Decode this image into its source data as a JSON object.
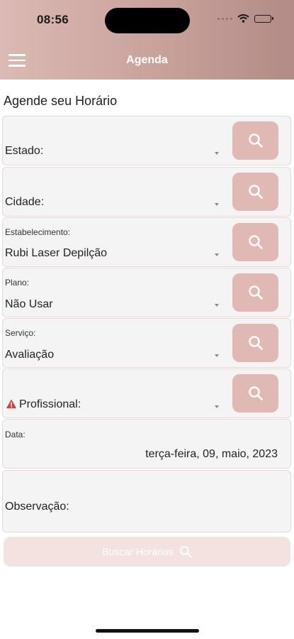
{
  "status_bar": {
    "time": "08:56"
  },
  "nav": {
    "title": "Agenda",
    "menu_icon": "hamburger-menu-icon"
  },
  "page": {
    "title": "Agende seu Horário"
  },
  "fields": {
    "estado": {
      "label": "Estado:"
    },
    "cidade": {
      "label": "Cidade:"
    },
    "estabelecimento": {
      "label": "Estabelecimento:",
      "value": "Rubi Laser Depilção"
    },
    "plano": {
      "label": "Plano:",
      "value": "Não Usar"
    },
    "servico": {
      "label": "Serviço:",
      "value": "Avaliação"
    },
    "profissional": {
      "label": "Profissional:",
      "icon": "warning-icon"
    },
    "data": {
      "label": "Data:",
      "value": "terça-feira, 09, maio, 2023"
    },
    "observacao": {
      "label": "Observação:"
    }
  },
  "actions": {
    "buscar_label": "Buscar Horários"
  },
  "colors": {
    "header_gradient_start": "#dcb9b4",
    "header_gradient_end": "#b38b86",
    "search_button": "#e0b9b4",
    "buscar_button": "#f3e2e0",
    "warning": "#e03a3a"
  }
}
